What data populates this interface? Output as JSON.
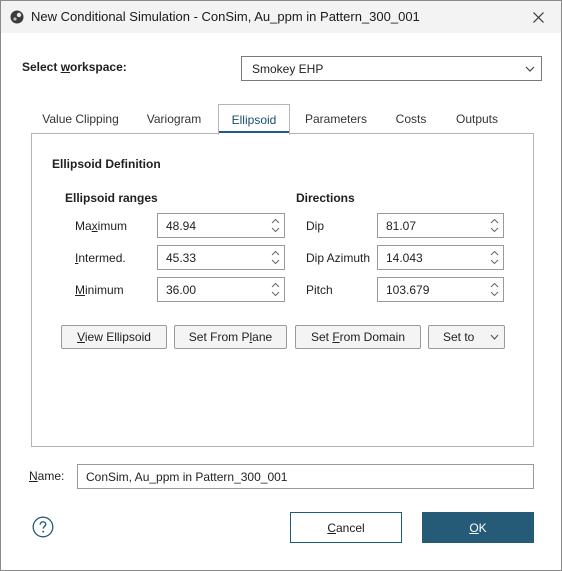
{
  "window": {
    "title": "New Conditional Simulation - ConSim, Au_ppm in Pattern_300_001"
  },
  "workspace": {
    "label": "Select workspace:",
    "value": "Smokey EHP"
  },
  "tabs": [
    {
      "label": "Value Clipping"
    },
    {
      "label": "Variogram"
    },
    {
      "label": "Ellipsoid"
    },
    {
      "label": "Parameters"
    },
    {
      "label": "Costs"
    },
    {
      "label": "Outputs"
    }
  ],
  "active_tab": "Ellipsoid",
  "ellipsoid": {
    "section_title": "Ellipsoid Definition",
    "ranges_title": "Ellipsoid ranges",
    "directions_title": "Directions",
    "ranges": [
      {
        "label": "Maximum",
        "value": "48.94"
      },
      {
        "label": "Intermed.",
        "value": "45.33"
      },
      {
        "label": "Minimum",
        "value": "36.00"
      }
    ],
    "directions": [
      {
        "label": "Dip",
        "value": "81.07"
      },
      {
        "label": "Dip Azimuth",
        "value": "14.043"
      },
      {
        "label": "Pitch",
        "value": "103.679"
      }
    ],
    "buttons": {
      "view": "View Ellipsoid",
      "set_from_plane": "Set From Plane",
      "set_from_domain": "Set From Domain",
      "set_to": "Set to"
    }
  },
  "name": {
    "label": "Name:",
    "value": "ConSim, Au_ppm in Pattern_300_001"
  },
  "footer": {
    "cancel": "Cancel",
    "ok": "OK",
    "help_icon": "help-circle-icon"
  },
  "colors": {
    "accent": "#265b78",
    "tab_underline": "#1f5a80"
  }
}
